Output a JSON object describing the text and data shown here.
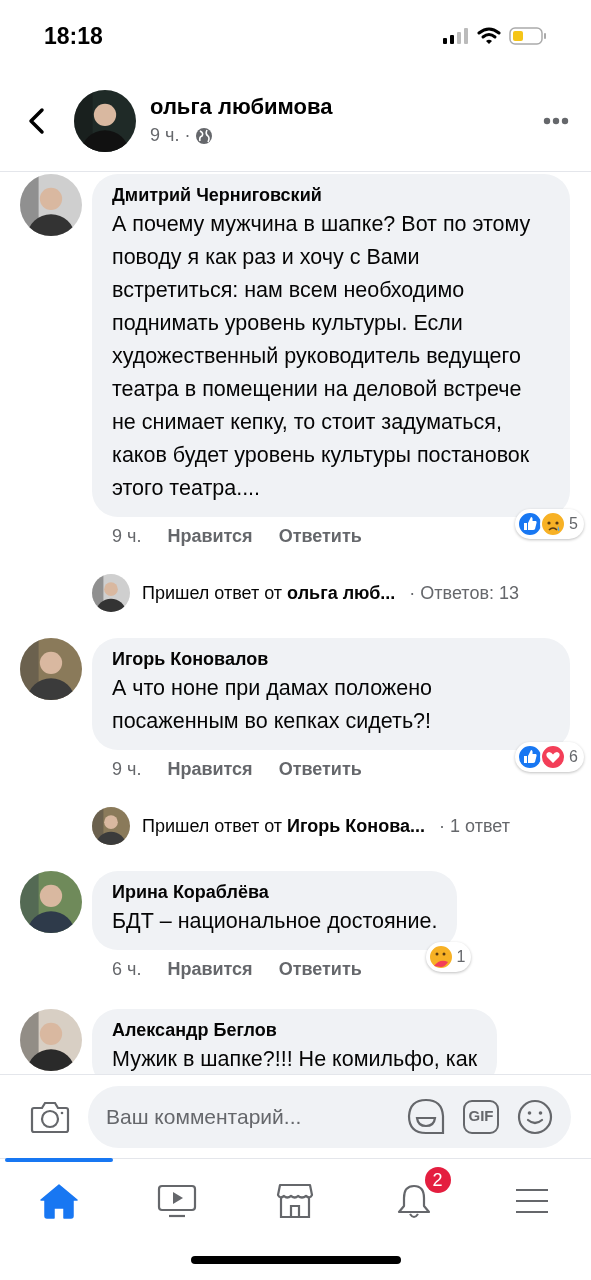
{
  "status_bar": {
    "time": "18:18"
  },
  "header": {
    "author": "ольга любимова",
    "time": "9 ч.",
    "separator": "·"
  },
  "comments": [
    {
      "author": "Дмитрий Черниговский",
      "text": "А почему мужчина в шапке? Вот по этому поводу я как раз и хочу с Вами встретиться: нам всем необходимо поднимать уровень культуры. Если художественный руководитель ведущего театра в помещении на деловой встрече не снимает кепку, то стоит задуматься, каков будет уровень культуры постановок этого театра....",
      "time": "9 ч.",
      "like": "Нравится",
      "reply": "Ответить",
      "reactions": [
        {
          "kind": "like"
        },
        {
          "kind": "sad"
        }
      ],
      "reaction_count": "5",
      "replies": {
        "text": "Пришел ответ от **ольга люб...**",
        "count": "· Ответов: 13"
      }
    },
    {
      "author": "Игорь Коновалов",
      "text": "А что ноне при дамах положено посаженным во кепках сидеть?!",
      "time": "9 ч.",
      "like": "Нравится",
      "reply": "Ответить",
      "reactions": [
        {
          "kind": "like"
        },
        {
          "kind": "love"
        }
      ],
      "reaction_count": "6",
      "replies": {
        "text": "Пришел ответ от **Игорь Конова...**",
        "count": "· 1 ответ"
      }
    },
    {
      "author": "Ирина Кораблёва",
      "text": "БДТ – национальное достояние.",
      "time": "6 ч.",
      "like": "Нравится",
      "reply": "Ответить",
      "reactions": [
        {
          "kind": "care"
        }
      ],
      "reaction_count": "1"
    },
    {
      "author": "Александр Беглов",
      "text": "Мужик в шапке?!!! Не комильфо, как"
    }
  ],
  "composer": {
    "placeholder": "Ваш комментарий...",
    "gif_label": "GIF"
  },
  "tabs": [
    {
      "kind": "home",
      "selected": true
    },
    {
      "kind": "video",
      "selected": false
    },
    {
      "kind": "marketplace",
      "selected": false
    },
    {
      "kind": "notifications",
      "selected": false,
      "badge": "2"
    },
    {
      "kind": "menu",
      "selected": false
    }
  ]
}
